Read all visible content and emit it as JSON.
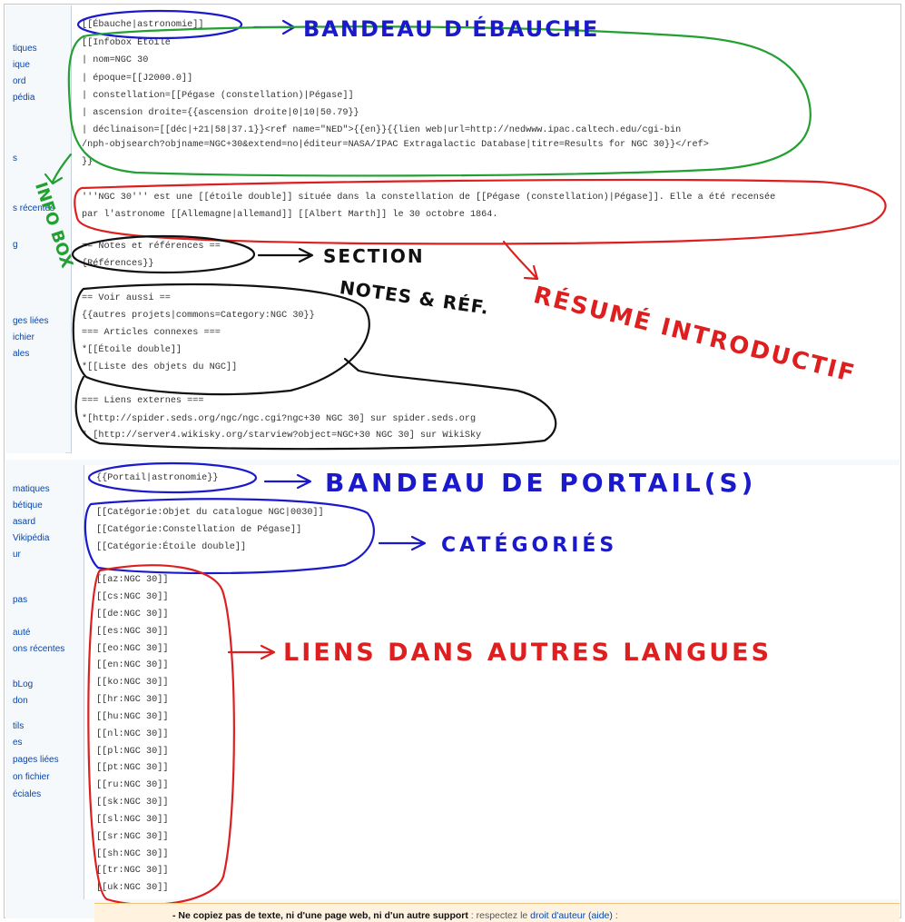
{
  "sidebar_top": [
    "tiques",
    "ique",
    "ord",
    "pédia",
    "s",
    "/INFO",
    "s récentes",
    "g",
    "ges liées",
    "ichier",
    "ales"
  ],
  "sidebar_bottom": [
    "matiques",
    "bétique",
    "asard",
    "Vikipédia",
    "ur",
    "pas",
    "auté",
    "ons récentes",
    "bLog",
    "don",
    "tils",
    "es",
    "pages liées",
    "on fichier",
    "éciales"
  ],
  "code_top": [
    "[[Ébauche|astronomie]]",
    "[[Infobox Étoile",
    "| nom=NGC 30",
    "| époque=[[J2000.0]]",
    "| constellation=[[Pégase (constellation)|Pégase]]",
    "| ascension droite={{ascension droite|0|10|50.79}}",
    "| déclinaison=[[déc|+21|58|37.1}}<ref name=\"NED\">{{en}}{{lien web|url=http://nedwww.ipac.caltech.edu/cgi-bin",
    "/nph-objsearch?objname=NGC+30&extend=no|éditeur=NASA/IPAC Extragalactic Database|titre=Results for NGC 30}}</ref>",
    "}}",
    "'''NGC 30''' est une [[étoile double]] située dans la constellation de [[Pégase (constellation)|Pégase]]. Elle a été recensée",
    "par l'astronome [[Allemagne|allemand]] [[Albert Marth]] le 30 octobre 1864.",
    "== Notes et références ==",
    "{Références}}",
    "== Voir aussi ==",
    "{{autres projets|commons=Category:NGC 30}}",
    "=== Articles connexes ===",
    "*[[Étoile double]]",
    "*[[Liste des objets du NGC]]",
    "=== Liens externes ===",
    "*[http://spider.seds.org/ngc/ngc.cgi?ngc+30 NGC 30] sur spider.seds.org",
    "* [http://server4.wikisky.org/starview?object=NGC+30 NGC 30] sur WikiSky"
  ],
  "code_bottom": [
    "{{Portail|astronomie}}",
    "[[Catégorie:Objet du catalogue NGC|0030]]",
    "[[Catégorie:Constellation de Pégase]]",
    "[[Catégorie:Étoile double]]"
  ],
  "interwiki": [
    "[[az:NGC 30]]",
    "[[cs:NGC 30]]",
    "[[de:NGC 30]]",
    "[[es:NGC 30]]",
    "[[eo:NGC 30]]",
    "[[en:NGC 30]]",
    "[[ko:NGC 30]]",
    "[[hr:NGC 30]]",
    "[[hu:NGC 30]]",
    "[[nl:NGC 30]]",
    "[[pl:NGC 30]]",
    "[[pt:NGC 30]]",
    "[[ru:NGC 30]]",
    "[[sk:NGC 30]]",
    "[[sl:NGC 30]]",
    "[[sr:NGC 30]]",
    "[[sh:NGC 30]]",
    "[[tr:NGC 30]]",
    "[[uk:NGC 30]]"
  ],
  "annotations": {
    "ebauche": "BANDEAU D'ÉBAUCHE",
    "infobox": "INFO BOX",
    "resume": "RÉSUMÉ INTRODUCTIF",
    "section_line1": "SECTION",
    "section_line2": "NOTES & RÉF.",
    "portail": "BANDEAU DE PORTAIL(S)",
    "categories": "CATÉGORIÉS",
    "langues": "LIENS DANS AUTRES LANGUES"
  },
  "notice": {
    "bold": "- Ne copiez pas de texte, ni d'une page web, ni d'un autre support",
    "sub": " : respectez le ",
    "link1": "droit d'auteur",
    "link2": "(aide)",
    "end": " :"
  }
}
